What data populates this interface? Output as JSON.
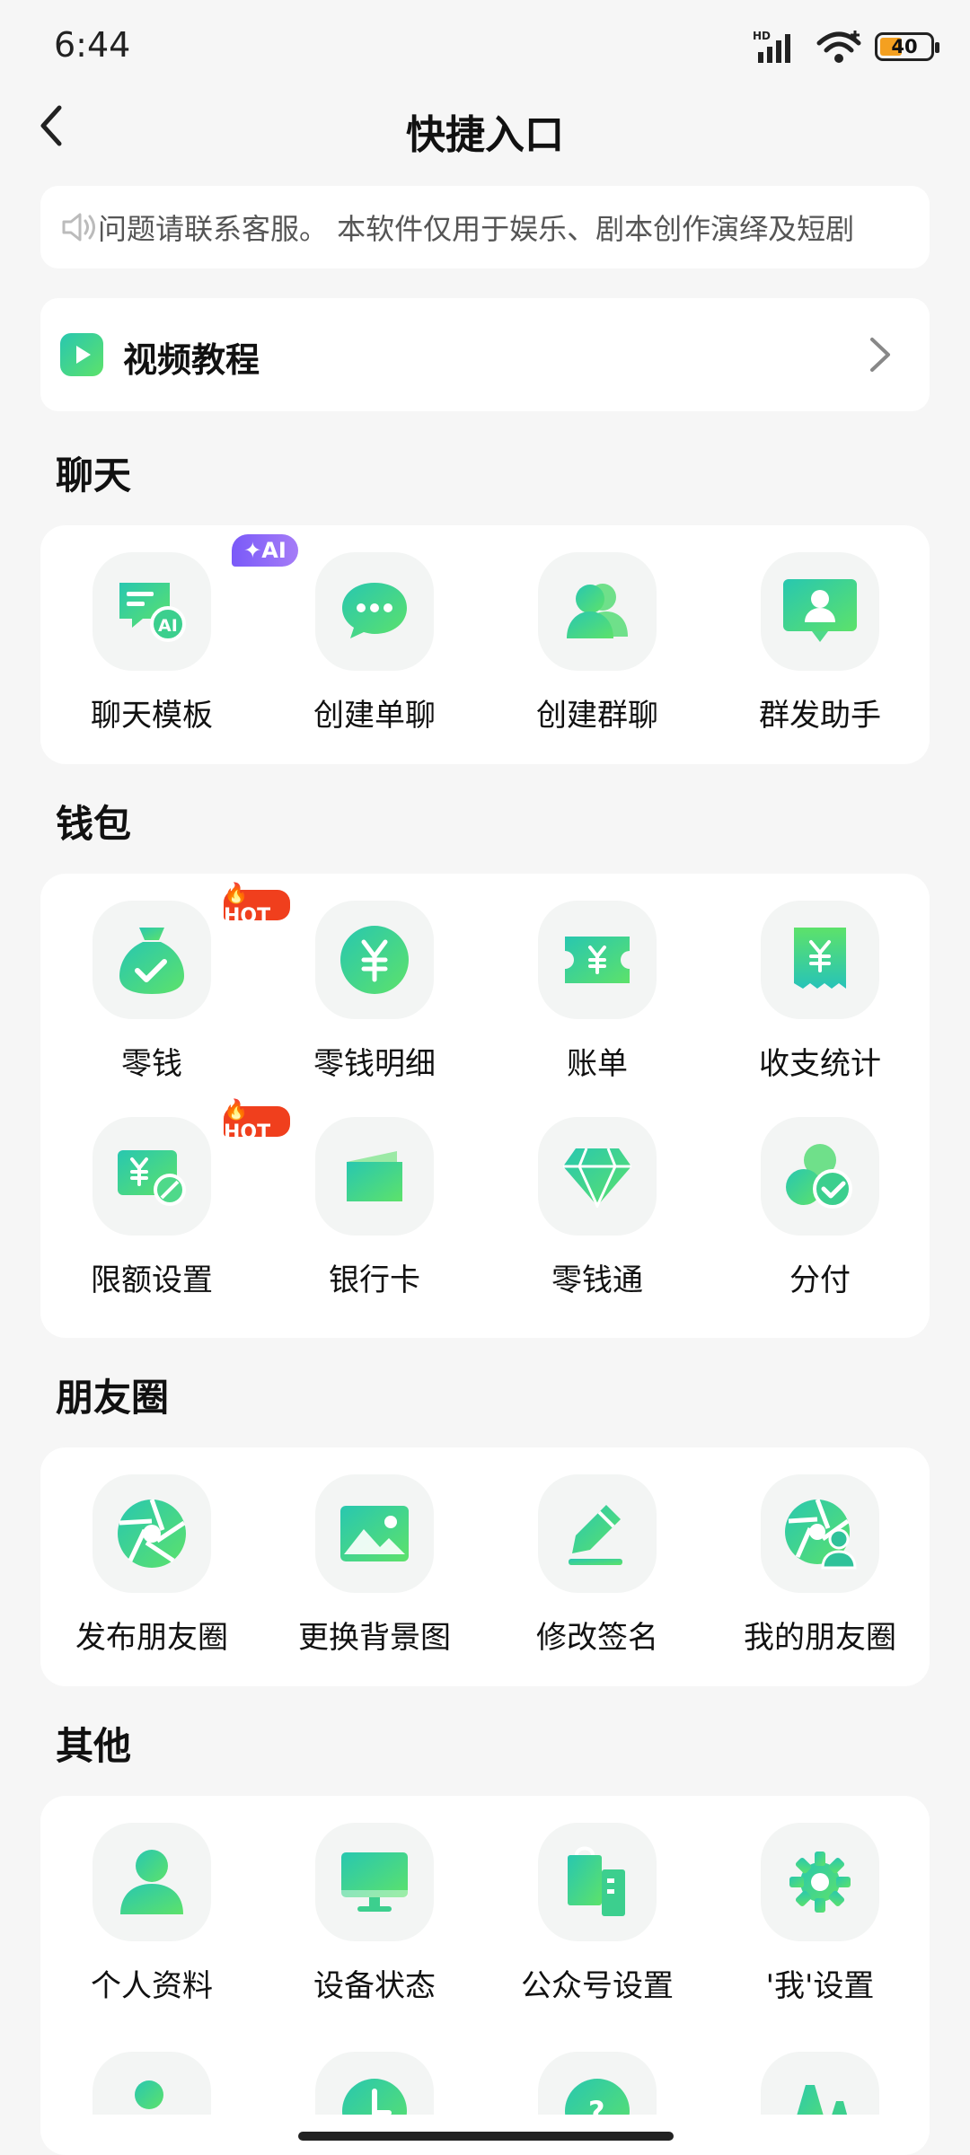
{
  "status_bar": {
    "time": "6:44",
    "network_label": "HD",
    "battery_level": "40",
    "battery_fraction": 0.4
  },
  "nav": {
    "title": "快捷入口"
  },
  "notice": {
    "text": "问题请联系客服。    本软件仅用于娱乐、剧本创作演绎及短剧"
  },
  "tutorial": {
    "label": "视频教程"
  },
  "colors": {
    "green_start": "#2fd0a0",
    "green_end": "#55e07a",
    "hot_badge": "#f03f1d",
    "ai_badge": "#8b67f8"
  },
  "sections": {
    "chat": {
      "title": "聊天",
      "items": [
        {
          "label": "聊天模板",
          "icon": "chat-template-ai-icon",
          "badge": "AI"
        },
        {
          "label": "创建单聊",
          "icon": "chat-bubble-icon"
        },
        {
          "label": "创建群聊",
          "icon": "group-people-icon"
        },
        {
          "label": "群发助手",
          "icon": "broadcast-assistant-icon"
        }
      ]
    },
    "wallet": {
      "title": "钱包",
      "items": [
        {
          "label": "零钱",
          "icon": "money-bag-icon",
          "badge": "HOT"
        },
        {
          "label": "零钱明细",
          "icon": "yuan-coin-icon"
        },
        {
          "label": "账单",
          "icon": "bill-ticket-icon"
        },
        {
          "label": "收支统计",
          "icon": "receipt-icon"
        },
        {
          "label": "限额设置",
          "icon": "limit-card-icon",
          "badge": "HOT"
        },
        {
          "label": "银行卡",
          "icon": "bank-card-icon"
        },
        {
          "label": "零钱通",
          "icon": "diamond-icon"
        },
        {
          "label": "分付",
          "icon": "installment-pay-icon"
        }
      ]
    },
    "moments": {
      "title": "朋友圈",
      "items": [
        {
          "label": "发布朋友圈",
          "icon": "moments-shutter-icon"
        },
        {
          "label": "更换背景图",
          "icon": "image-background-icon"
        },
        {
          "label": "修改签名",
          "icon": "pencil-edit-icon"
        },
        {
          "label": "我的朋友圈",
          "icon": "my-moments-icon"
        }
      ]
    },
    "other": {
      "title": "其他",
      "items": [
        {
          "label": "个人资料",
          "icon": "person-profile-icon"
        },
        {
          "label": "设备状态",
          "icon": "monitor-device-icon"
        },
        {
          "label": "公众号设置",
          "icon": "official-account-icon"
        },
        {
          "label": "'我'设置",
          "icon": "settings-gear-icon"
        }
      ],
      "partial_icons": [
        "person-add-icon",
        "clock-icon",
        "help-icon",
        "font-size-icon"
      ]
    }
  }
}
